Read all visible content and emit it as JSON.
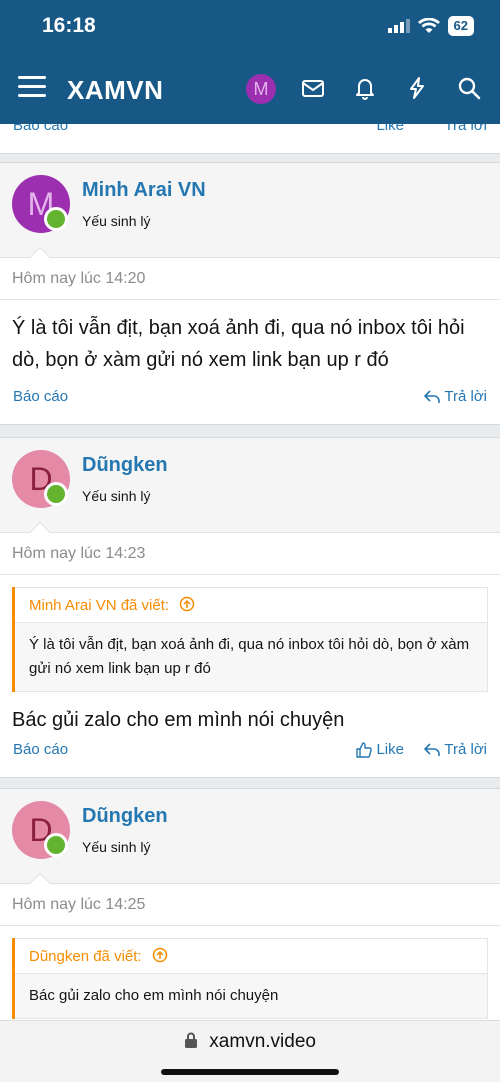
{
  "status_bar": {
    "time": "16:18",
    "battery": "62"
  },
  "nav": {
    "logo": "XAMVN",
    "avatar_letter": "M",
    "icons": [
      "menu-icon",
      "mail-icon",
      "bell-icon",
      "lightning-icon",
      "search-icon"
    ]
  },
  "prev_post_footer": {
    "report": "Báo cáo",
    "like": "Like",
    "reply": "Trả lời"
  },
  "posts": [
    {
      "avatar_letter": "M",
      "avatar_bg": "#9c2fb0",
      "avatar_fg": "#e3b5ec",
      "username": "Minh Arai VN",
      "user_title": "Yếu sinh lý",
      "date": "Hôm nay lúc 14:20",
      "body": "Ý là tôi vẫn địt, bạn xoá ảnh đi, qua nó inbox tôi hỏi dò, bọn ở xàm gửi nó xem link bạn up r đó",
      "report": "Báo cáo",
      "reply": "Trả lời"
    },
    {
      "avatar_letter": "D",
      "avatar_bg": "#e48aa6",
      "avatar_fg": "#8a1f3f",
      "username": "Dũngken",
      "user_title": "Yếu sinh lý",
      "date": "Hôm nay lúc 14:23",
      "quote_author": "Minh Arai VN đã viết:",
      "quote_text": "Ý là tôi vẫn địt, bạn xoá ảnh đi, qua nó inbox tôi hỏi dò, bọn ở xàm gửi nó xem link bạn up r đó",
      "body": "Bác gủi zalo cho em mình nói chuyện",
      "report": "Báo cáo",
      "like": "Like",
      "reply": "Trả lời"
    },
    {
      "avatar_letter": "D",
      "avatar_bg": "#e48aa6",
      "avatar_fg": "#8a1f3f",
      "username": "Dũngken",
      "user_title": "Yếu sinh lý",
      "date": "Hôm nay lúc 14:25",
      "quote_author": "Dũngken đã viết:",
      "quote_text": "Bác gủi zalo cho em mình nói chuyện"
    }
  ],
  "browser": {
    "url": "xamvn.video"
  }
}
